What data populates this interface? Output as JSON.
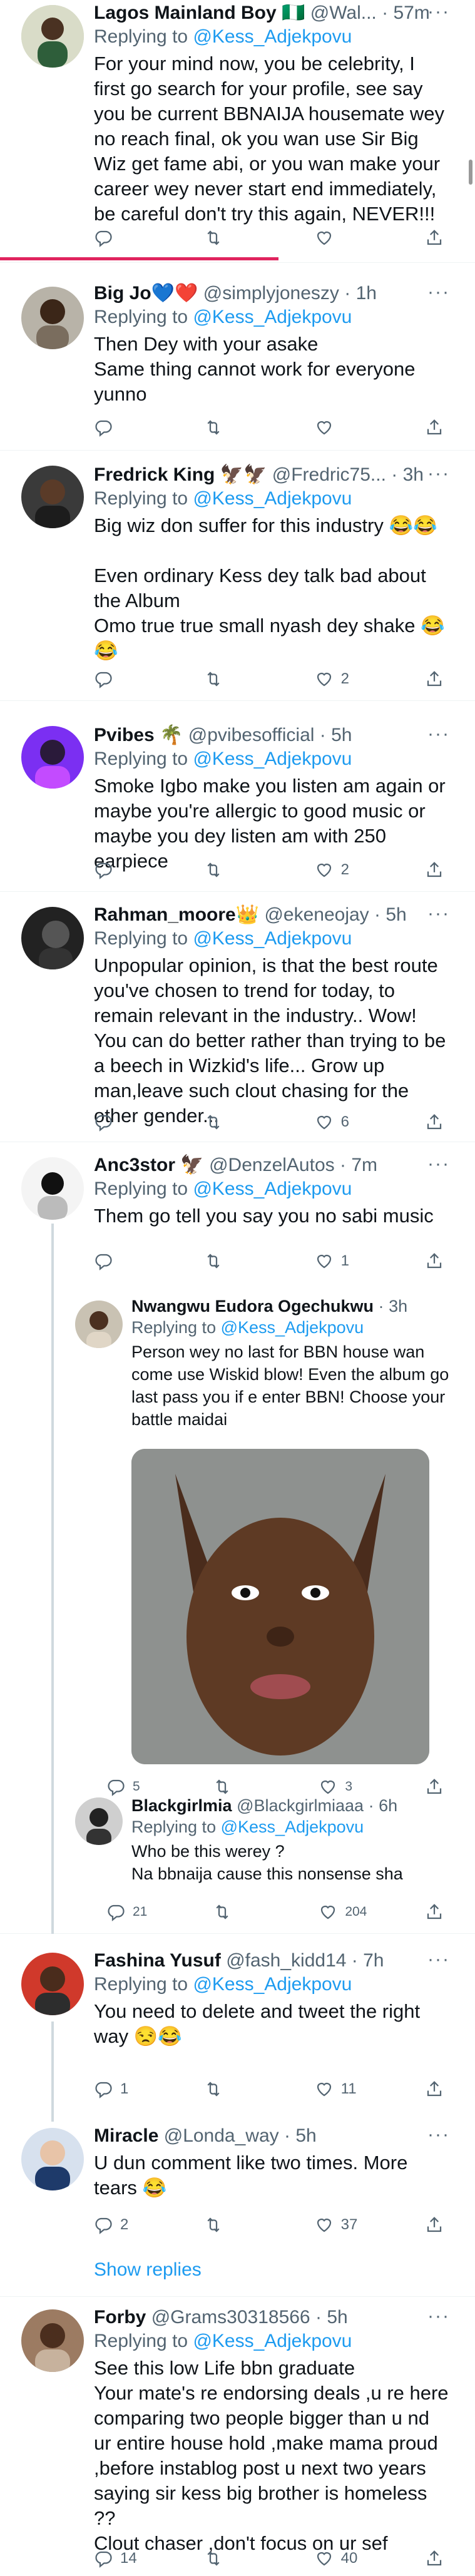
{
  "tweets": [
    {
      "name": "Lagos Mainland Boy 🇳🇬",
      "handle": "@Wal...",
      "time": "57m",
      "reply_prefix": "Replying to",
      "reply_to": "@Kess_Adjekpovu",
      "text": "For your mind now, you be celebrity, I first go search for your profile, see say you be current BBNAIJA housemate wey no reach final, ok you wan use Sir Big Wiz get fame abi, or you wan make your career wey never start end immediately, be careful don't try this again, NEVER!!!",
      "replies": "",
      "retweets": "",
      "likes": ""
    },
    {
      "name": "Big Jo💙❤️",
      "handle": "@simplyjoneszy",
      "time": "1h",
      "reply_prefix": "Replying to",
      "reply_to": "@Kess_Adjekpovu",
      "text": "Then Dey with your asake\nSame thing cannot work for everyone yunno",
      "replies": "",
      "retweets": "",
      "likes": ""
    },
    {
      "name": "Fredrick King 🦅🦅",
      "handle": "@Fredric75...",
      "time": "3h",
      "reply_prefix": "Replying to",
      "reply_to": "@Kess_Adjekpovu",
      "text": "Big wiz don suffer for this industry 😂😂\n\nEven ordinary Kess dey talk bad about the Album\nOmo true true small nyash dey shake 😂😂",
      "replies": "",
      "retweets": "",
      "likes": "2"
    },
    {
      "name": "Pvibes 🌴",
      "handle": "@pvibesofficial",
      "time": "5h",
      "reply_prefix": "Replying to",
      "reply_to": "@Kess_Adjekpovu",
      "text": "Smoke Igbo make you listen am again or maybe you're allergic to good music or maybe you dey listen am with 250 earpiece",
      "replies": "",
      "retweets": "",
      "likes": "2"
    },
    {
      "name": "Rahman_moore👑",
      "handle": "@ekeneojay",
      "time": "5h",
      "reply_prefix": "Replying to",
      "reply_to": "@Kess_Adjekpovu",
      "text": "Unpopular opinion, is that the best route you've chosen to trend for today, to remain relevant in the industry.. Wow! You can do better rather than trying to be a beech in Wizkid's life... Grow up man,leave such clout chasing for the other gender...",
      "replies": "",
      "retweets": "",
      "likes": "6"
    },
    {
      "name": "Anc3stor 🦅",
      "handle": "@DenzelAutos",
      "time": "7m",
      "reply_prefix": "Replying to",
      "reply_to": "@Kess_Adjekpovu",
      "text": "Them go tell you say you no sabi music",
      "replies": "",
      "retweets": "",
      "likes": "1"
    },
    {
      "name": "Nwangwu Eudora Ogechukwu",
      "handle": "",
      "time": "3h",
      "reply_prefix": "Replying to",
      "reply_to": "@Kess_Adjekpovu",
      "text": "Person wey no last  for BBN house wan come use Wiskid blow! Even the album go last pass you if e enter BBN! Choose your battle maidai",
      "replies": "5",
      "retweets": "",
      "likes": "3"
    },
    {
      "name": "Blackgirlmia",
      "handle": "@Blackgirlmiaaa",
      "time": "6h",
      "reply_prefix": "Replying to",
      "reply_to": "@Kess_Adjekpovu",
      "text": "Who be this werey ?\nNa bbnaija cause this nonsense sha",
      "replies": "21",
      "retweets": "",
      "likes": "204"
    },
    {
      "name": "Fashina Yusuf",
      "handle": "@fash_kidd14",
      "time": "7h",
      "reply_prefix": "Replying to",
      "reply_to": "@Kess_Adjekpovu",
      "text": "You need to delete and tweet the right way 😒😂",
      "replies": "1",
      "retweets": "",
      "likes": "11"
    },
    {
      "name": "Miracle",
      "handle": "@Londa_way",
      "time": "5h",
      "reply_prefix": "",
      "reply_to": "",
      "text": "U dun comment like two times. More tears 😂",
      "replies": "2",
      "retweets": "",
      "likes": "37"
    },
    {
      "name": "Forby",
      "handle": "@Grams30318566",
      "time": "5h",
      "reply_prefix": "Replying to",
      "reply_to": "@Kess_Adjekpovu",
      "text": "See this lᴏw Life bbn graduate\nYour mate's re endorsing deals ,u re here comparing two people bigger than u nd ur entire house hold ,make mama proud ,before instablog post u next two years saying sir kess big brother is hᴏmeless ??\nClout chaser ,don't focus on ur sef",
      "replies": "14",
      "retweets": "",
      "likes": "40"
    }
  ],
  "show_replies": "Show replies",
  "dot": "·",
  "more": "···",
  "icons": [
    "reply-icon",
    "retweet-icon",
    "like-icon",
    "share-icon"
  ]
}
